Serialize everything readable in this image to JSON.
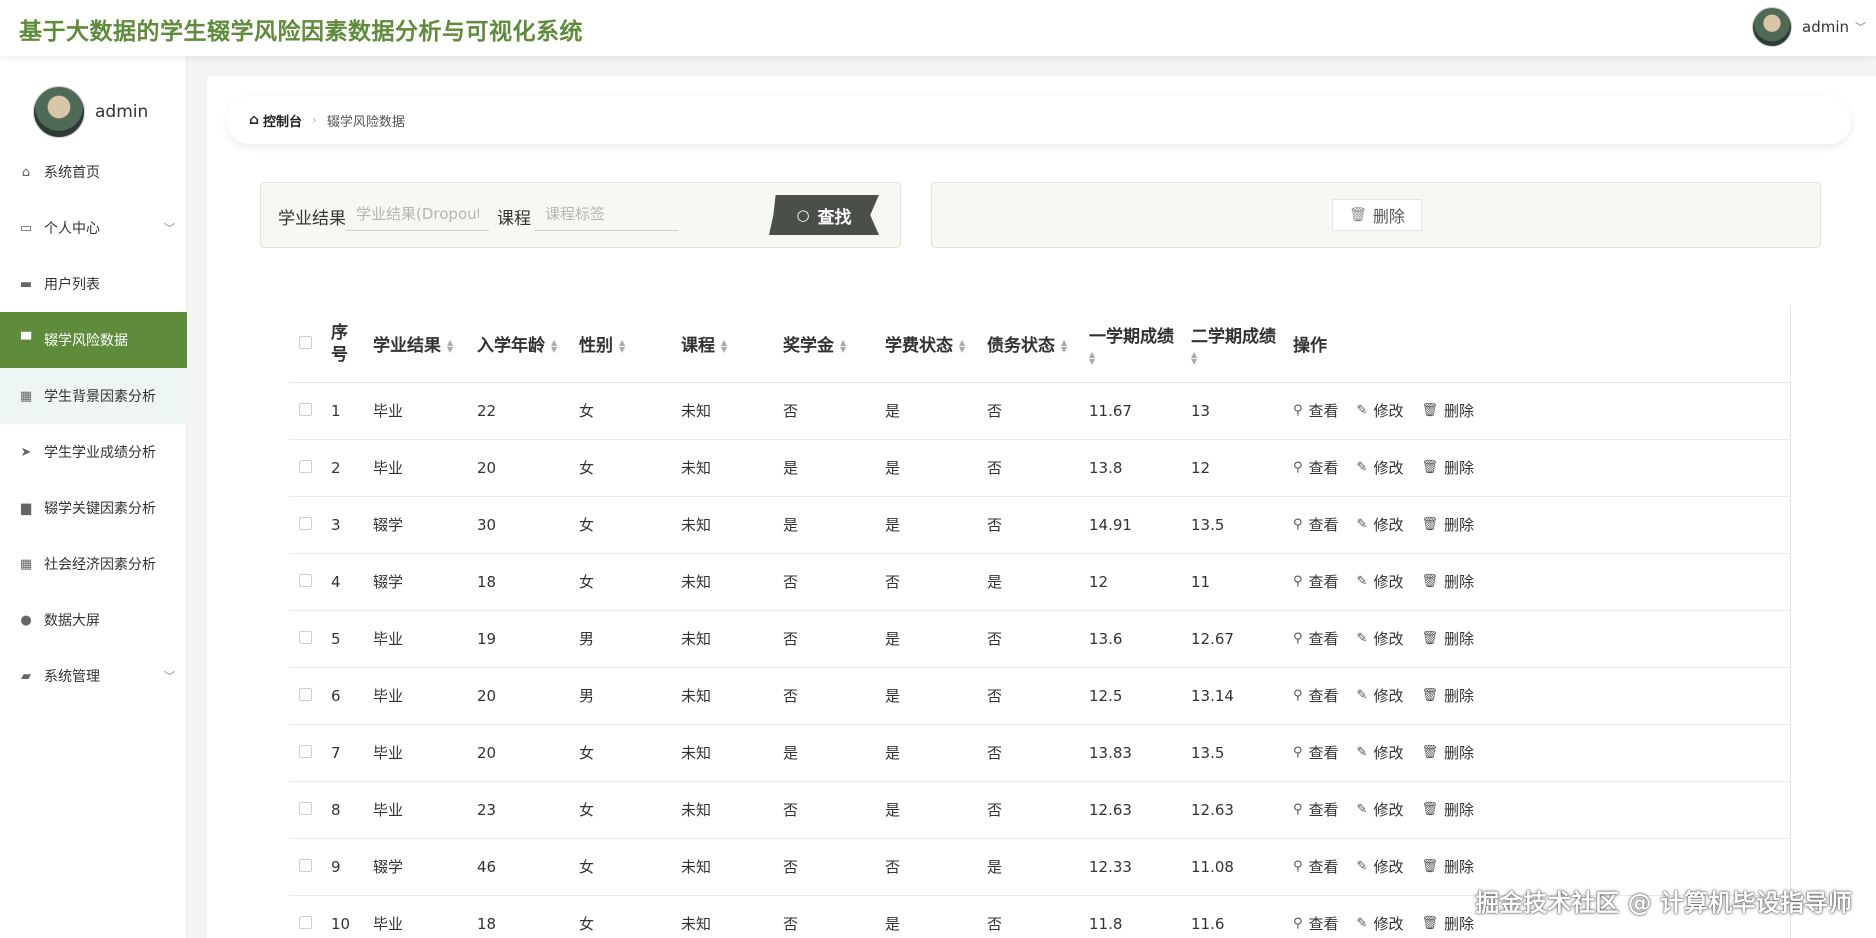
{
  "header": {
    "title": "基于大数据的学生辍学风险因素数据分析与可视化系统",
    "user": "admin"
  },
  "sidebar": {
    "user": "admin",
    "items": [
      {
        "label": "系统首页",
        "icon": "home-icon",
        "glyph": "⌂"
      },
      {
        "label": "个人中心",
        "icon": "id-card-icon",
        "glyph": "▭",
        "chevron": true
      },
      {
        "label": "用户列表",
        "icon": "briefcase-icon",
        "glyph": "▬"
      },
      {
        "label": "辍学风险数据",
        "icon": "monitor-icon",
        "glyph": "▀",
        "active": true
      },
      {
        "label": "学生背景因素分析",
        "icon": "grid-icon",
        "glyph": "▦",
        "hover": true
      },
      {
        "label": "学生学业成绩分析",
        "icon": "paper-plane-icon",
        "glyph": "➤"
      },
      {
        "label": "辍学关键因素分析",
        "icon": "book-icon",
        "glyph": "▆"
      },
      {
        "label": "社会经济因素分析",
        "icon": "apps-icon",
        "glyph": "▦"
      },
      {
        "label": "数据大屏",
        "icon": "person-icon",
        "glyph": "●"
      },
      {
        "label": "系统管理",
        "icon": "ticket-icon",
        "glyph": "▰",
        "chevron": true
      }
    ]
  },
  "breadcrumb": {
    "home": "控制台",
    "current": "辍学风险数据"
  },
  "search": {
    "label1": "学业结果",
    "placeholder1": "学业结果(Dropout/Gr",
    "label2": "课程",
    "placeholder2": "课程标签",
    "button": "查找"
  },
  "actions": {
    "delete": "删除"
  },
  "table": {
    "headers": [
      "序号",
      "学业结果",
      "入学年龄",
      "性别",
      "课程",
      "奖学金",
      "学费状态",
      "债务状态",
      "一学期成绩",
      "二学期成绩",
      "操作"
    ],
    "ops": {
      "view": "查看",
      "edit": "修改",
      "delete": "删除"
    },
    "rows": [
      [
        "1",
        "毕业",
        "22",
        "女",
        "未知",
        "否",
        "是",
        "否",
        "11.67",
        "13"
      ],
      [
        "2",
        "毕业",
        "20",
        "女",
        "未知",
        "是",
        "是",
        "否",
        "13.8",
        "12"
      ],
      [
        "3",
        "辍学",
        "30",
        "女",
        "未知",
        "是",
        "是",
        "否",
        "14.91",
        "13.5"
      ],
      [
        "4",
        "辍学",
        "18",
        "女",
        "未知",
        "否",
        "否",
        "是",
        "12",
        "11"
      ],
      [
        "5",
        "毕业",
        "19",
        "男",
        "未知",
        "否",
        "是",
        "否",
        "13.6",
        "12.67"
      ],
      [
        "6",
        "毕业",
        "20",
        "男",
        "未知",
        "否",
        "是",
        "否",
        "12.5",
        "13.14"
      ],
      [
        "7",
        "毕业",
        "20",
        "女",
        "未知",
        "是",
        "是",
        "否",
        "13.83",
        "13.5"
      ],
      [
        "8",
        "毕业",
        "23",
        "女",
        "未知",
        "否",
        "是",
        "否",
        "12.63",
        "12.63"
      ],
      [
        "9",
        "辍学",
        "46",
        "女",
        "未知",
        "否",
        "否",
        "是",
        "12.33",
        "11.08"
      ],
      [
        "10",
        "毕业",
        "18",
        "女",
        "未知",
        "否",
        "是",
        "否",
        "11.8",
        "11.6"
      ]
    ]
  },
  "watermark": "掘金技术社区 @ 计算机毕设指导师",
  "colors": {
    "accent": "#5e8c3a",
    "panel": "#f8f8f2",
    "button_dark": "#4a4f4a"
  }
}
